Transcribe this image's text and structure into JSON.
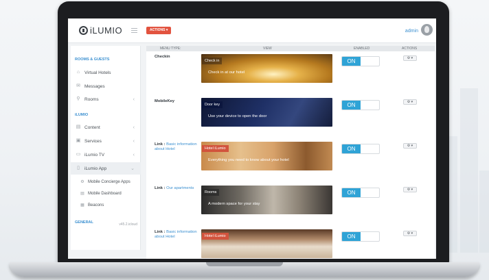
{
  "topbar": {
    "logo_text": "iLUMIO",
    "actions_label": "ACTIONS ▾",
    "admin_label": "admin"
  },
  "sidebar": {
    "section_rooms": "ROOMS & GUESTS",
    "virtual_hotels": "Virtual Hotels",
    "messages": "Messages",
    "rooms": "Rooms",
    "section_ilumio": "iLUMIO",
    "content": "Content",
    "services": "Services",
    "ilumio_tv": "iLumio TV",
    "ilumio_app": "iLumio App",
    "mobile_concierge": "Mobile Concierge Apps",
    "mobile_dashboard": "Mobile Dashboard",
    "beacons": "Beacons",
    "section_general": "GENERAL",
    "version": "v45.2.icloud"
  },
  "table": {
    "col_menu_type": "MENU TYPE:",
    "col_view": "VIEW",
    "col_enabled": "ENABLED",
    "col_actions": "ACTIONS"
  },
  "rows": [
    {
      "label": "Checkin",
      "tag": "Check in",
      "sub": "Check in at our hotel",
      "toggle": "ON",
      "gear": "⚙ ▾"
    },
    {
      "label": "MobileKey",
      "tag": "Door key",
      "sub": "Use your device to open the door",
      "toggle": "ON",
      "gear": "⚙ ▾"
    },
    {
      "label_prefix": "Link : ",
      "label_link": "Basic information about Hotel",
      "tag": "Hotel iLumio",
      "sub": "Everything you need to know about your hotel",
      "toggle": "ON",
      "gear": "⚙ ▾"
    },
    {
      "label_prefix": "Link : ",
      "label_link": "Our apartments",
      "tag": "Rooms",
      "sub": "A modern space for your stay",
      "toggle": "ON",
      "gear": "⚙ ▾"
    },
    {
      "label_prefix": "Link : ",
      "label_link": "Basic information about Hotel",
      "tag": "Hotel iLumio",
      "sub": "",
      "toggle": "ON",
      "gear": "⚙ ▾"
    }
  ],
  "colors": {
    "accent": "#2fa3d6",
    "actions_red": "#e2533f",
    "link_blue": "#3a8fd0"
  }
}
